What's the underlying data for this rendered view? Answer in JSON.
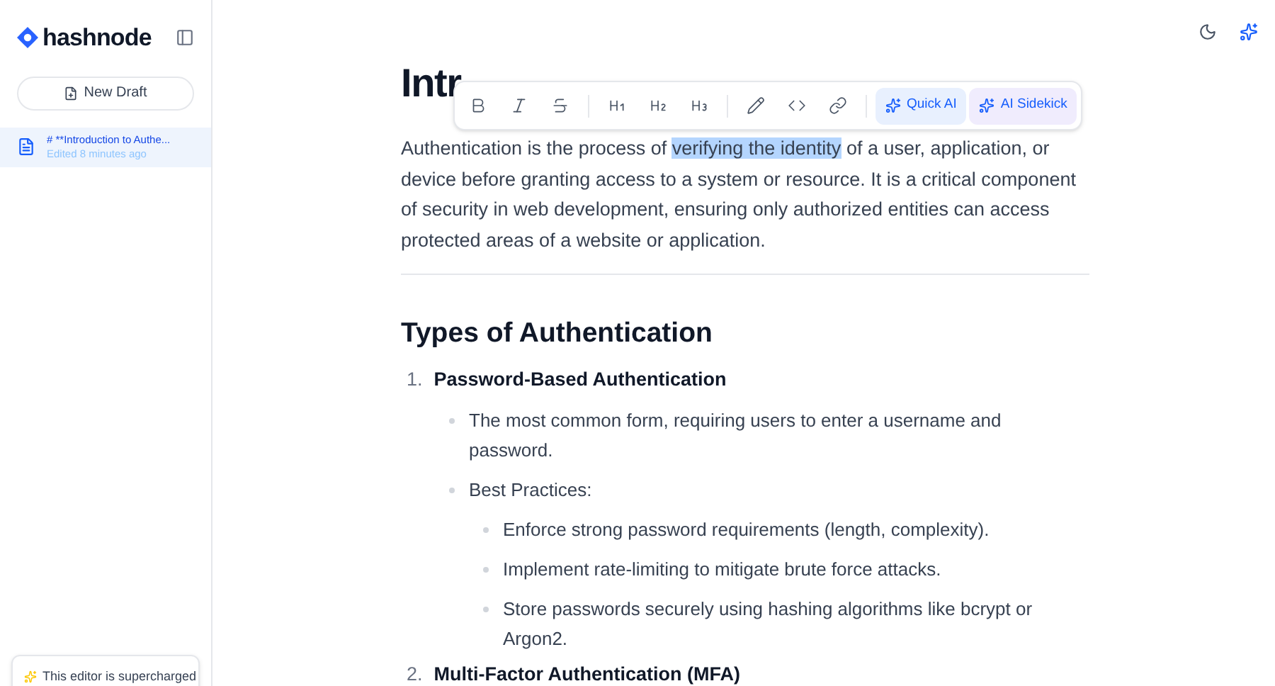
{
  "sidebar": {
    "logo": "hashnode",
    "new_draft": "New Draft",
    "drafts": [
      {
        "title": "# **Introduction to Authe...",
        "meta": "Edited 8 minutes ago",
        "selected": true
      }
    ],
    "promo": "This editor is supercharged"
  },
  "toolbar": {
    "buttons": [
      {
        "kind": "bold"
      },
      {
        "kind": "italic"
      },
      {
        "kind": "strike"
      },
      {
        "kind": "sep"
      },
      {
        "kind": "h1"
      },
      {
        "kind": "h2"
      },
      {
        "kind": "h3"
      },
      {
        "kind": "sep"
      },
      {
        "kind": "pen"
      },
      {
        "kind": "code"
      },
      {
        "kind": "link"
      },
      {
        "kind": "sep"
      },
      {
        "kind": "quick_ai",
        "label": "Quick AI"
      },
      {
        "kind": "sidekick",
        "label": "AI Sidekick"
      }
    ]
  },
  "article": {
    "title": "Intr",
    "intro": {
      "before": "Authentication is the process of ",
      "selected": "verifying the identity",
      "after": " of a user, application, or device before granting access to a system or resource. It is a critical component of security in web development, ensuring only authorized entities can access protected areas of a website or application."
    },
    "heading": "Types of Authentication",
    "list": [
      {
        "number": "1.",
        "title": "Password-Based Authentication",
        "children": [
          {
            "text": "The most common form, requiring users to enter a username and password."
          },
          {
            "text": "Best Practices:",
            "children": [
              {
                "text": "Enforce strong password requirements (length, complexity)."
              },
              {
                "text": "Implement rate-limiting to mitigate brute force attacks."
              },
              {
                "text": "Store passwords securely using hashing algorithms like bcrypt or Argon2."
              }
            ]
          }
        ]
      },
      {
        "number": "2.",
        "title": "Multi-Factor Authentication (MFA)"
      }
    ]
  }
}
